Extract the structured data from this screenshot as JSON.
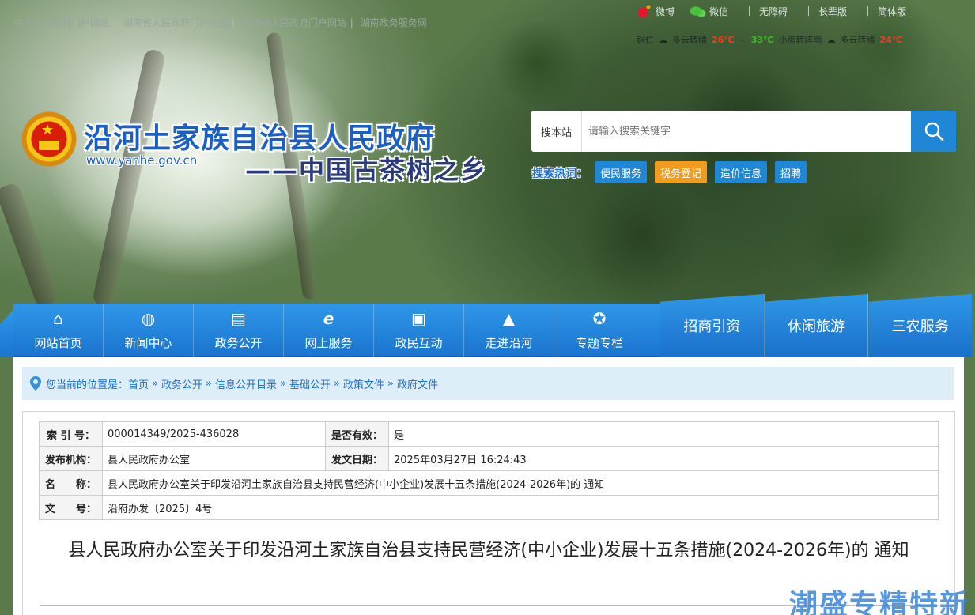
{
  "topbar": {
    "links": [
      "中央人民政府门户网站",
      "湖南省人民政府门户网站",
      "湘西州人民政府门户网站",
      "湖南政务服务网"
    ],
    "weibo": "微博",
    "wechat": "微信",
    "extra": [
      "无障碍",
      "长辈版",
      "简体版"
    ],
    "weather": {
      "city": "铜仁",
      "cond1": "多云转晴",
      "high1": "26℃",
      "low1": "33℃",
      "day2": "小雨转阵雨",
      "cond3": "多云转晴",
      "temp3": "24℃"
    }
  },
  "header": {
    "title": "沿河土家族自治县人民政府",
    "url": "www.yanhe.gov.cn",
    "slogan": "——中国古茶树之乡"
  },
  "search": {
    "scope": "搜本站",
    "placeholder": "请输入搜索关键字",
    "hot_label": "搜索热词：",
    "hot_tags": [
      "便民服务",
      "税务登记",
      "造价信息",
      "招聘"
    ]
  },
  "nav": {
    "items": [
      {
        "label": "网站首页",
        "icon": "home-icon"
      },
      {
        "label": "新闻中心",
        "icon": "globe-icon"
      },
      {
        "label": "政务公开",
        "icon": "id-card-icon"
      },
      {
        "label": "网上服务",
        "icon": "ie-icon"
      },
      {
        "label": "政民互动",
        "icon": "chat-icon"
      },
      {
        "label": "走进沿河",
        "icon": "landmark-icon"
      },
      {
        "label": "专题专栏",
        "icon": "award-icon"
      }
    ],
    "featured": [
      "招商引资",
      "休闲旅游",
      "三农服务"
    ]
  },
  "breadcrumb": {
    "prefix": "您当前的位置是：",
    "items": [
      "首页",
      "政务公开",
      "信息公开目录",
      "基础公开",
      "政策文件",
      "政府文件"
    ],
    "separator": "»"
  },
  "meta": {
    "index_label": "索 引 号：",
    "index_value": "000014349/2025-436028",
    "valid_label": "是否有效：",
    "valid_value": "是",
    "org_label": "发布机构：",
    "org_value": "县人民政府办公室",
    "date_label": "发文日期：",
    "date_value": "2025年03月27日 16:24:43",
    "name_label": "名　　称：",
    "name_value": "县人民政府办公室关于印发沿河土家族自治县支持民营经济(中小企业)发展十五条措施(2024-2026年)的 通知",
    "docno_label": "文　　号：",
    "docno_value": "沿府办发〔2025〕4号"
  },
  "document": {
    "title": "县人民政府办公室关于印发沿河土家族自治县支持民营经济(中小企业)发展十五条措施(2024-2026年)的 通知"
  },
  "watermark": "潮盛专精特新",
  "colors": {
    "primary": "#1a75cf",
    "accent_orange": "#f29c1f",
    "breadcrumb_bg": "#ddeef9"
  }
}
